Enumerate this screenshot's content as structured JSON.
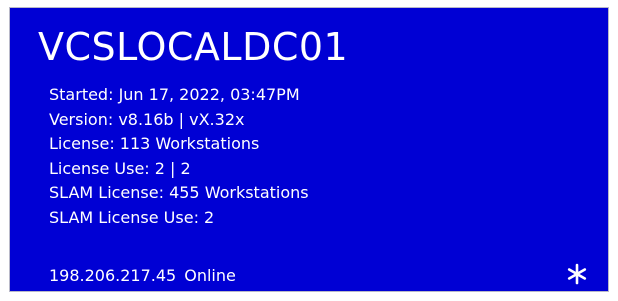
{
  "tile": {
    "background_color": "#0000d4",
    "text_color": "#ffffff",
    "server_name": "VCSLOCALDC01",
    "info_lines": [
      "Started: Jun 17, 2022, 03:47PM",
      "Version: v8.16b | vX.32x",
      "License: 113 Workstations",
      "License Use: 2 | 2",
      "SLAM License: 455 Workstations",
      "SLAM License Use: 2"
    ],
    "footer": {
      "ip_address": "198.206.217.45",
      "status": "Online",
      "icon": "asterisk-icon"
    }
  }
}
